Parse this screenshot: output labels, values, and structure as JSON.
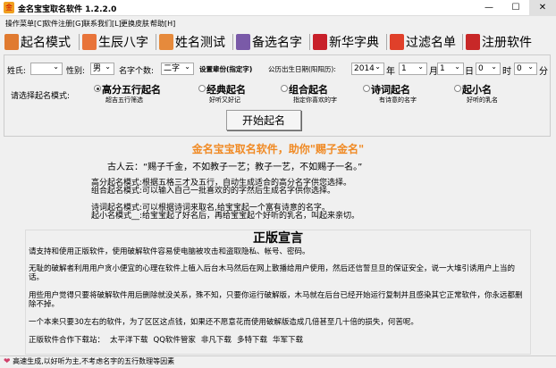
{
  "window": {
    "title": "金名宝宝取名软件 1.2.2.0",
    "minimize": "—",
    "maximize": "☐",
    "close": "✕"
  },
  "menu": [
    "操作菜单[C]",
    "软件注册[G]",
    "联系我们[L]",
    "更换皮肤",
    "帮助[H]"
  ],
  "toolbar": [
    {
      "label": "起名模式",
      "icon": "briefcase-icon",
      "color": "#e07a30"
    },
    {
      "label": "生辰八字",
      "icon": "clock-icon",
      "color": "#e8743a"
    },
    {
      "label": "姓名测试",
      "icon": "calculator-icon",
      "color": "#e68a3c"
    },
    {
      "label": "备选名字",
      "icon": "calendar-icon",
      "color": "#7a5aa8"
    },
    {
      "label": "新华字典",
      "icon": "folder-icon",
      "color": "#c8202a"
    },
    {
      "label": "过滤名单",
      "icon": "x-filter-icon",
      "color": "#e0402a"
    },
    {
      "label": "注册软件",
      "icon": "lock-icon",
      "color": "#c82828"
    }
  ],
  "form": {
    "surname_label": "姓氏:",
    "surname": "",
    "gender_label": "性别:",
    "gender": "男",
    "count_label": "名字个数:",
    "count": "二字",
    "generation_label": "设置辈份(指定字)",
    "birth_label": "公历出生日期(阳阳历):",
    "year": "2014",
    "year_unit": "年",
    "month": "1",
    "month_unit": "月",
    "day": "1",
    "day_unit": "日",
    "hour": "0",
    "hour_unit": "时",
    "minute": "0",
    "minute_unit": "分"
  },
  "mode_label": "请选择起名模式:",
  "modes": [
    {
      "label": "高分五行起名",
      "sub": "超吉五行筛选",
      "selected": true
    },
    {
      "label": "经典起名",
      "sub": "好听又好记",
      "selected": false
    },
    {
      "label": "组合起名",
      "sub": "指定你喜欢的字",
      "selected": false
    },
    {
      "label": "诗词起名",
      "sub": "有诗意的名字",
      "selected": false
    },
    {
      "label": "起小名",
      "sub": "好听的乳名",
      "selected": false
    }
  ],
  "start_button": "开始起名",
  "headline": "金名宝宝取名软件，助你\"赐子金名\"",
  "quote": "古人云：“赐子千金，不如教子一艺；教子一艺，不如赐子一名。”",
  "descriptions": [
    "高分起名模式:根据五格三才及五行，自动生成适合的高分名字供您选择。",
    "组合起名模式:可以输入自己一批喜欢的的字然后生成名字供你选择。",
    "诗词起名模式:可以根据诗词来取名,给宝宝起一个富有诗意的名字。",
    "起小名模式__:给宝宝起了好名后，再给宝宝起个好听的乳名，叫起来亲切。"
  ],
  "declaration": {
    "title": "正版宣言",
    "paragraphs": [
      "请支持和使用正版软件，使用破解软件容易使电脑被攻击和盗取隐私、帐号、密码。",
      "无耻的破解者利用用户贪小便宜的心理在软件上植入后台木马然后在网上散播给用户使用，然后还信誓旦旦的保证安全，说一大堆引诱用户上当的话。",
      "用些用户觉得只要将破解软件用后删除就没关系，殊不知，只要你运行破解版，木马就在后台已经开始运行复制并且感染其它正常软件，你永远都删除不掉。",
      "一个本来只要30左右的软件，为了区区这点钱，如果还不愿意花而使用破解版造成几倍甚至几十倍的损失，何苦呢。"
    ],
    "download_label": "正版软件合作下载站：",
    "sites": [
      "太平洋下载",
      "QQ软件管家",
      "非凡下载",
      "多特下载",
      "华军下载"
    ]
  },
  "status": "高速生成,以好听为主,不考虑名字的五行数理等因素"
}
